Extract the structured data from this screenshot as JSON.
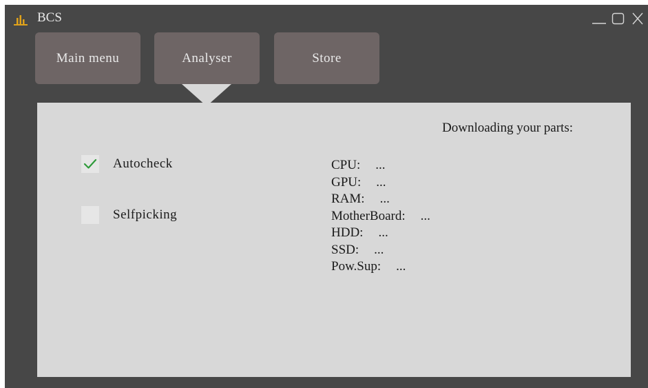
{
  "window": {
    "title": "BCS",
    "controls": [
      "minimize-icon",
      "maximize-icon",
      "close-icon"
    ]
  },
  "tabs": [
    {
      "label": "Main menu"
    },
    {
      "label": "Analyser",
      "active": true
    },
    {
      "label": "Store"
    }
  ],
  "analyser": {
    "heading": "Downloading your parts:",
    "options": [
      {
        "label": "Autocheck",
        "checked": true
      },
      {
        "label": "Selfpicking",
        "checked": false
      }
    ],
    "parts": [
      {
        "name": "CPU:",
        "value": "..."
      },
      {
        "name": "GPU:",
        "value": "..."
      },
      {
        "name": "RAM:",
        "value": "..."
      },
      {
        "name": "MotherBoard:",
        "value": "..."
      },
      {
        "name": "HDD:",
        "value": "..."
      },
      {
        "name": "SSD:",
        "value": "..."
      },
      {
        "name": "Pow.Sup:",
        "value": "..."
      }
    ]
  },
  "colors": {
    "window_bg": "#474747",
    "tab_bg": "#6e6565",
    "panel_bg": "#d8d8d8",
    "check_green": "#2e9a3a",
    "icon_orange": "#e0a21a"
  }
}
